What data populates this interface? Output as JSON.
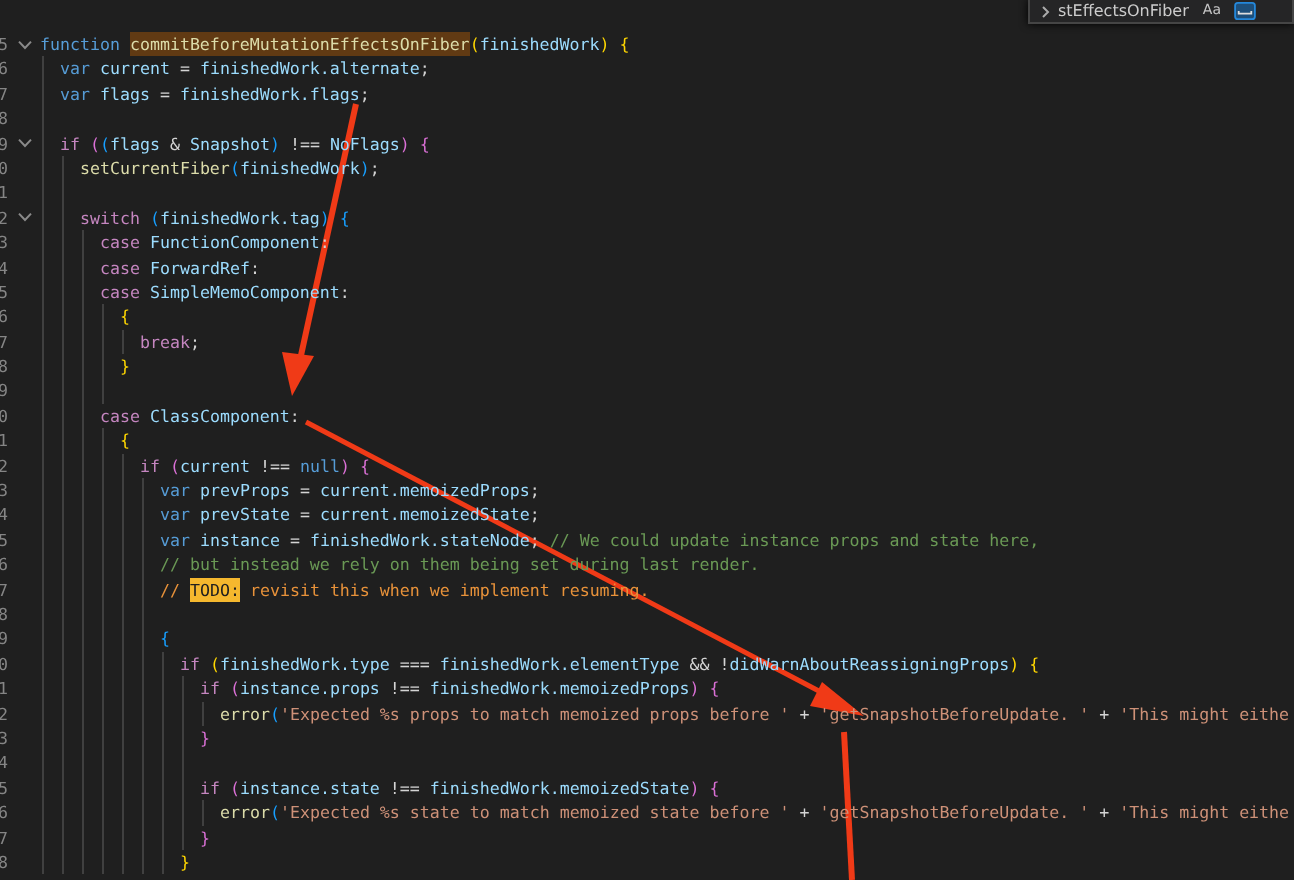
{
  "find_widget": {
    "query": "stEffectsOnFiber",
    "match_case": {
      "label": "Aa",
      "on": false
    },
    "whole_word": {
      "on": true
    }
  },
  "lines": [
    {
      "number": "5",
      "fold": true,
      "tokens": [
        {
          "kind": "kw",
          "text": "function "
        },
        {
          "kind": "match",
          "text": "commitBeforeMutationEffectsOnFiber"
        },
        {
          "kind": "b1",
          "text": "("
        },
        {
          "kind": "id",
          "text": "finishedWork"
        },
        {
          "kind": "b1",
          "text": ") "
        },
        {
          "kind": "b1",
          "text": "{"
        }
      ],
      "children": [
        {
          "number": "6",
          "fold": false,
          "tokens": [
            {
              "kind": "kw",
              "text": "var "
            },
            {
              "kind": "id",
              "text": "current"
            },
            {
              "kind": "p",
              "text": " = "
            },
            {
              "kind": "id",
              "text": "finishedWork.alternate"
            },
            {
              "kind": "p",
              "text": ";"
            }
          ]
        },
        {
          "number": "7",
          "fold": false,
          "tokens": [
            {
              "kind": "kw",
              "text": "var "
            },
            {
              "kind": "id",
              "text": "flags"
            },
            {
              "kind": "p",
              "text": " = "
            },
            {
              "kind": "id",
              "text": "finishedWork.flags"
            },
            {
              "kind": "p",
              "text": ";"
            }
          ]
        },
        {
          "number": "8",
          "fold": false
        },
        {
          "number": "9",
          "fold": true,
          "tokens": [
            {
              "kind": "ctrl",
              "text": "if "
            },
            {
              "kind": "b2",
              "text": "("
            },
            {
              "kind": "b3",
              "text": "("
            },
            {
              "kind": "id",
              "text": "flags"
            },
            {
              "kind": "p",
              "text": " & "
            },
            {
              "kind": "id",
              "text": "Snapshot"
            },
            {
              "kind": "b3",
              "text": ")"
            },
            {
              "kind": "p",
              "text": " !== "
            },
            {
              "kind": "id",
              "text": "NoFlags"
            },
            {
              "kind": "b2",
              "text": ") "
            },
            {
              "kind": "b2",
              "text": "{"
            }
          ],
          "children": [
            {
              "number": "0",
              "fold": false,
              "tokens": [
                {
                  "kind": "fn",
                  "text": "setCurrentFiber"
                },
                {
                  "kind": "b3",
                  "text": "("
                },
                {
                  "kind": "id",
                  "text": "finishedWork"
                },
                {
                  "kind": "b3",
                  "text": ")"
                },
                {
                  "kind": "p",
                  "text": ";"
                }
              ]
            },
            {
              "number": "1",
              "fold": false
            },
            {
              "number": "2",
              "fold": true,
              "tokens": [
                {
                  "kind": "ctrl",
                  "text": "switch "
                },
                {
                  "kind": "b3",
                  "text": "("
                },
                {
                  "kind": "id",
                  "text": "finishedWork.tag"
                },
                {
                  "kind": "b3",
                  "text": ") "
                },
                {
                  "kind": "b3",
                  "text": "{"
                }
              ],
              "children": [
                {
                  "number": "3",
                  "fold": false,
                  "tokens": [
                    {
                      "kind": "ctrl",
                      "text": "case "
                    },
                    {
                      "kind": "id",
                      "text": "FunctionComponent"
                    },
                    {
                      "kind": "p",
                      "text": ":"
                    }
                  ]
                },
                {
                  "number": "4",
                  "fold": false,
                  "tokens": [
                    {
                      "kind": "ctrl",
                      "text": "case "
                    },
                    {
                      "kind": "id",
                      "text": "ForwardRef"
                    },
                    {
                      "kind": "p",
                      "text": ":"
                    }
                  ]
                },
                {
                  "number": "5",
                  "fold": false,
                  "tokens": [
                    {
                      "kind": "ctrl",
                      "text": "case "
                    },
                    {
                      "kind": "id",
                      "text": "SimpleMemoComponent"
                    },
                    {
                      "kind": "p",
                      "text": ":"
                    }
                  ],
                  "children": [
                    {
                      "number": "6",
                      "fold": false,
                      "tokens": [
                        {
                          "kind": "b1",
                          "text": "{"
                        }
                      ],
                      "children": [
                        {
                          "number": "7",
                          "fold": false,
                          "tokens": [
                            {
                              "kind": "ctrl",
                              "text": "break"
                            },
                            {
                              "kind": "p",
                              "text": ";"
                            }
                          ]
                        }
                      ]
                    },
                    {
                      "number": "8",
                      "fold": false,
                      "tokens": [
                        {
                          "kind": "b1",
                          "text": "}"
                        }
                      ]
                    },
                    {
                      "number": "9",
                      "fold": false
                    }
                  ]
                },
                {
                  "number": "0",
                  "fold": false,
                  "tokens": [
                    {
                      "kind": "ctrl",
                      "text": "case "
                    },
                    {
                      "kind": "id",
                      "text": "ClassComponent"
                    },
                    {
                      "kind": "p",
                      "text": ":"
                    }
                  ],
                  "children": [
                    {
                      "number": "1",
                      "fold": false,
                      "tokens": [
                        {
                          "kind": "b1",
                          "text": "{"
                        }
                      ],
                      "children": [
                        {
                          "number": "2",
                          "fold": false,
                          "tokens": [
                            {
                              "kind": "ctrl",
                              "text": "if "
                            },
                            {
                              "kind": "b2",
                              "text": "("
                            },
                            {
                              "kind": "id",
                              "text": "current"
                            },
                            {
                              "kind": "p",
                              "text": " !== "
                            },
                            {
                              "kind": "kw",
                              "text": "null"
                            },
                            {
                              "kind": "b2",
                              "text": ") "
                            },
                            {
                              "kind": "b2",
                              "text": "{"
                            }
                          ],
                          "children": [
                            {
                              "number": "3",
                              "fold": false,
                              "tokens": [
                                {
                                  "kind": "kw",
                                  "text": "var "
                                },
                                {
                                  "kind": "id",
                                  "text": "prevProps"
                                },
                                {
                                  "kind": "p",
                                  "text": " = "
                                },
                                {
                                  "kind": "id",
                                  "text": "current.memoizedProps"
                                },
                                {
                                  "kind": "p",
                                  "text": ";"
                                }
                              ]
                            },
                            {
                              "number": "4",
                              "fold": false,
                              "tokens": [
                                {
                                  "kind": "kw",
                                  "text": "var "
                                },
                                {
                                  "kind": "id",
                                  "text": "prevState"
                                },
                                {
                                  "kind": "p",
                                  "text": " = "
                                },
                                {
                                  "kind": "id",
                                  "text": "current.memoizedState"
                                },
                                {
                                  "kind": "p",
                                  "text": ";"
                                }
                              ]
                            },
                            {
                              "number": "5",
                              "fold": false,
                              "tokens": [
                                {
                                  "kind": "kw",
                                  "text": "var "
                                },
                                {
                                  "kind": "id",
                                  "text": "instance"
                                },
                                {
                                  "kind": "p",
                                  "text": " = "
                                },
                                {
                                  "kind": "id",
                                  "text": "finishedWork.stateNode"
                                },
                                {
                                  "kind": "p",
                                  "text": "; "
                                },
                                {
                                  "kind": "cmt",
                                  "text": "// We could update instance props and state here,"
                                }
                              ]
                            },
                            {
                              "number": "6",
                              "fold": false,
                              "tokens": [
                                {
                                  "kind": "cmt",
                                  "text": "// but instead we rely on them being set during last render."
                                }
                              ]
                            },
                            {
                              "number": "7",
                              "fold": false,
                              "tokens": [
                                {
                                  "kind": "todocmt",
                                  "text": "// "
                                },
                                {
                                  "kind": "todo",
                                  "text": "TODO:"
                                },
                                {
                                  "kind": "todocmt",
                                  "text": " revisit this when we implement resuming."
                                }
                              ]
                            },
                            {
                              "number": "8",
                              "fold": false
                            },
                            {
                              "number": "9",
                              "fold": false,
                              "tokens": [
                                {
                                  "kind": "b3",
                                  "text": "{"
                                }
                              ],
                              "children": [
                                {
                                  "number": "0",
                                  "fold": false,
                                  "tokens": [
                                    {
                                      "kind": "ctrl",
                                      "text": "if "
                                    },
                                    {
                                      "kind": "b1",
                                      "text": "("
                                    },
                                    {
                                      "kind": "id",
                                      "text": "finishedWork.type"
                                    },
                                    {
                                      "kind": "p",
                                      "text": " === "
                                    },
                                    {
                                      "kind": "id",
                                      "text": "finishedWork.elementType"
                                    },
                                    {
                                      "kind": "p",
                                      "text": " && !"
                                    },
                                    {
                                      "kind": "id",
                                      "text": "didWarnAboutReassigningProps"
                                    },
                                    {
                                      "kind": "b1",
                                      "text": ") "
                                    },
                                    {
                                      "kind": "b1",
                                      "text": "{"
                                    }
                                  ],
                                  "children": [
                                    {
                                      "number": "1",
                                      "fold": false,
                                      "tokens": [
                                        {
                                          "kind": "ctrl",
                                          "text": "if "
                                        },
                                        {
                                          "kind": "b2",
                                          "text": "("
                                        },
                                        {
                                          "kind": "id",
                                          "text": "instance.props"
                                        },
                                        {
                                          "kind": "p",
                                          "text": " !== "
                                        },
                                        {
                                          "kind": "id",
                                          "text": "finishedWork.memoizedProps"
                                        },
                                        {
                                          "kind": "b2",
                                          "text": ") "
                                        },
                                        {
                                          "kind": "b2",
                                          "text": "{"
                                        }
                                      ],
                                      "children": [
                                        {
                                          "number": "2",
                                          "fold": false,
                                          "tokens": [
                                            {
                                              "kind": "fn",
                                              "text": "error"
                                            },
                                            {
                                              "kind": "b3",
                                              "text": "("
                                            },
                                            {
                                              "kind": "str",
                                              "text": "'Expected %s props to match memoized props before '"
                                            },
                                            {
                                              "kind": "p",
                                              "text": " + "
                                            },
                                            {
                                              "kind": "str",
                                              "text": "'getSnapshotBeforeUpdate. '"
                                            },
                                            {
                                              "kind": "p",
                                              "text": " + "
                                            },
                                            {
                                              "kind": "str",
                                              "text": "'This might eithe"
                                            }
                                          ]
                                        }
                                      ]
                                    },
                                    {
                                      "number": "3",
                                      "fold": false,
                                      "tokens": [
                                        {
                                          "kind": "b2",
                                          "text": "}"
                                        }
                                      ]
                                    },
                                    {
                                      "number": "4",
                                      "fold": false
                                    },
                                    {
                                      "number": "5",
                                      "fold": false,
                                      "tokens": [
                                        {
                                          "kind": "ctrl",
                                          "text": "if "
                                        },
                                        {
                                          "kind": "b2",
                                          "text": "("
                                        },
                                        {
                                          "kind": "id",
                                          "text": "instance.state"
                                        },
                                        {
                                          "kind": "p",
                                          "text": " !== "
                                        },
                                        {
                                          "kind": "id",
                                          "text": "finishedWork.memoizedState"
                                        },
                                        {
                                          "kind": "b2",
                                          "text": ") "
                                        },
                                        {
                                          "kind": "b2",
                                          "text": "{"
                                        }
                                      ],
                                      "children": [
                                        {
                                          "number": "6",
                                          "fold": false,
                                          "tokens": [
                                            {
                                              "kind": "fn",
                                              "text": "error"
                                            },
                                            {
                                              "kind": "b3",
                                              "text": "("
                                            },
                                            {
                                              "kind": "str",
                                              "text": "'Expected %s state to match memoized state before '"
                                            },
                                            {
                                              "kind": "p",
                                              "text": " + "
                                            },
                                            {
                                              "kind": "str",
                                              "text": "'getSnapshotBeforeUpdate. '"
                                            },
                                            {
                                              "kind": "p",
                                              "text": " + "
                                            },
                                            {
                                              "kind": "str",
                                              "text": "'This might eithe"
                                            }
                                          ]
                                        }
                                      ]
                                    },
                                    {
                                      "number": "7",
                                      "fold": false,
                                      "tokens": [
                                        {
                                          "kind": "b2",
                                          "text": "}"
                                        }
                                      ]
                                    }
                                  ]
                                },
                                {
                                  "number": "8",
                                  "fold": false,
                                  "tokens": [
                                    {
                                      "kind": "b1",
                                      "text": "}"
                                    }
                                  ]
                                }
                              ]
                            }
                          ]
                        }
                      ]
                    }
                  ]
                }
              ]
            }
          ]
        }
      ]
    }
  ]
}
